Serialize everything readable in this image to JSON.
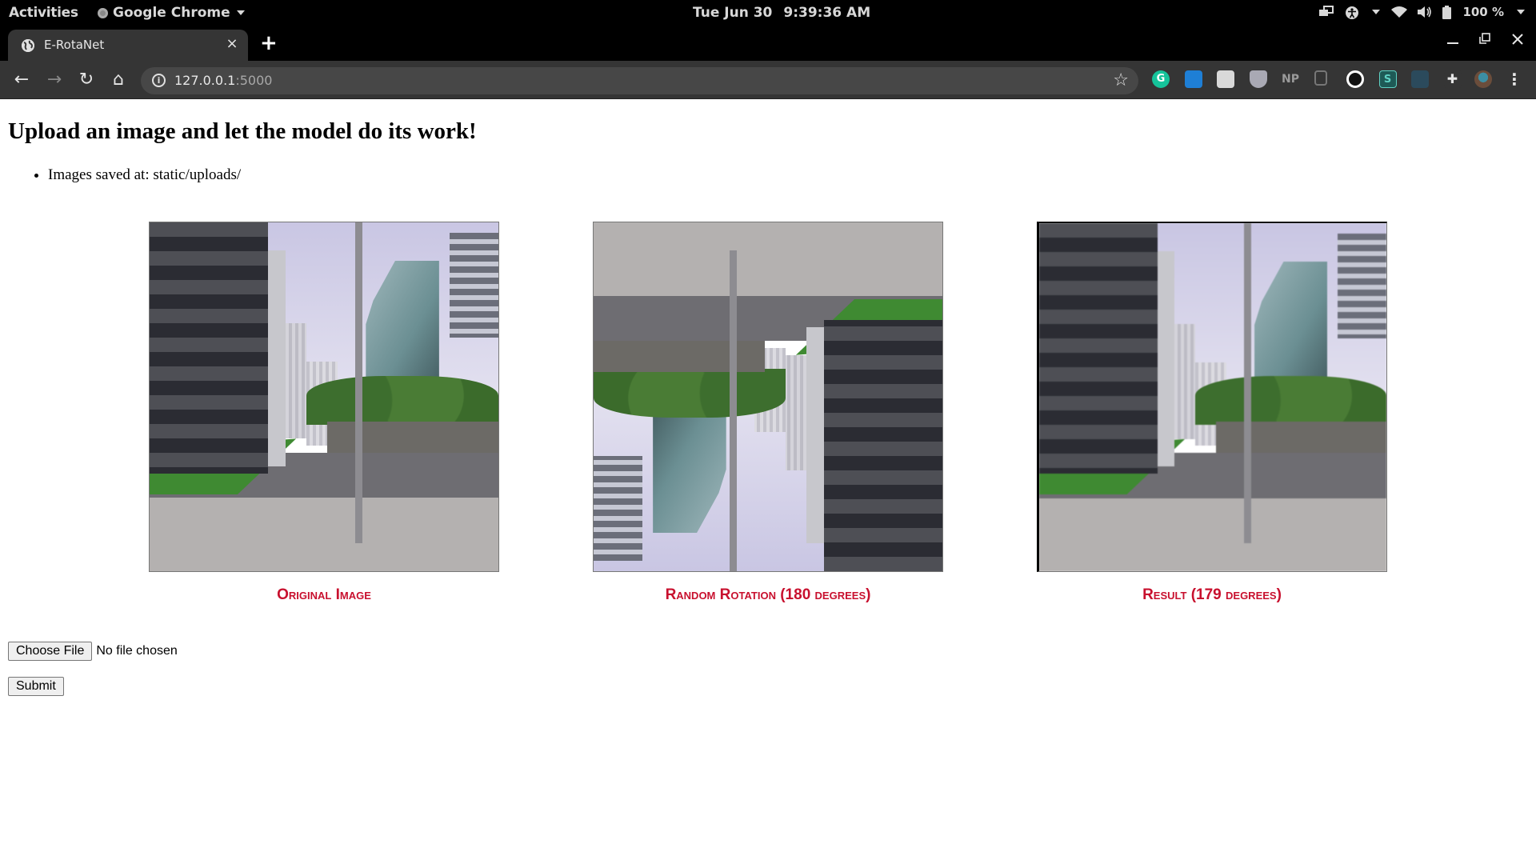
{
  "system_bar": {
    "activities": "Activities",
    "app_name": "Google Chrome",
    "date": "Tue Jun 30",
    "time": "9:39:36 AM",
    "battery": "100 %",
    "tray_icons": [
      "display-icon",
      "accessibility-icon",
      "wifi-icon",
      "volume-icon",
      "battery-icon"
    ]
  },
  "browser": {
    "tab_title": "E-RotaNet",
    "tab_close": "×",
    "new_tab": "+",
    "url_host": "127.0.0.1",
    "url_port": ":5000",
    "nav": {
      "back": "←",
      "forward": "→",
      "reload": "↻",
      "home": "⌂"
    },
    "extensions": [
      {
        "name": "grammarly-icon",
        "label": "G",
        "color": "#15c39a"
      },
      {
        "name": "trello-icon",
        "label": "",
        "color": "#1e7fd6"
      },
      {
        "name": "pdf-extension-icon",
        "label": "",
        "color": "#d9d9d9"
      },
      {
        "name": "shield-extension-icon",
        "label": "",
        "color": "#a9a9b4"
      },
      {
        "name": "np-extension-icon",
        "label": "NP",
        "color": "#353535"
      },
      {
        "name": "copy-extension-icon",
        "label": "",
        "color": "#353535"
      },
      {
        "name": "github-icon",
        "label": "",
        "color": "#111111"
      },
      {
        "name": "s-extension-icon",
        "label": "S",
        "color": "#1e5a56"
      },
      {
        "name": "glasses-extension-icon",
        "label": "",
        "color": "#2b4a5c"
      },
      {
        "name": "puzzle-extensions-icon",
        "label": "",
        "color": "#353535"
      }
    ]
  },
  "page": {
    "heading": "Upload an image and let the model do its work!",
    "info_items": [
      "Images saved at: static/uploads/"
    ],
    "gallery": [
      {
        "caption": "Original Image",
        "rotation_degrees": 0
      },
      {
        "caption": "Random Rotation (180 degrees)",
        "rotation_degrees": 180
      },
      {
        "caption": "Result (179 degrees)",
        "rotation_degrees": 179
      }
    ],
    "accent_color": "#c8102e",
    "form": {
      "choose_file_label": "Choose File",
      "file_status": "No file chosen",
      "submit_label": "Submit"
    }
  }
}
